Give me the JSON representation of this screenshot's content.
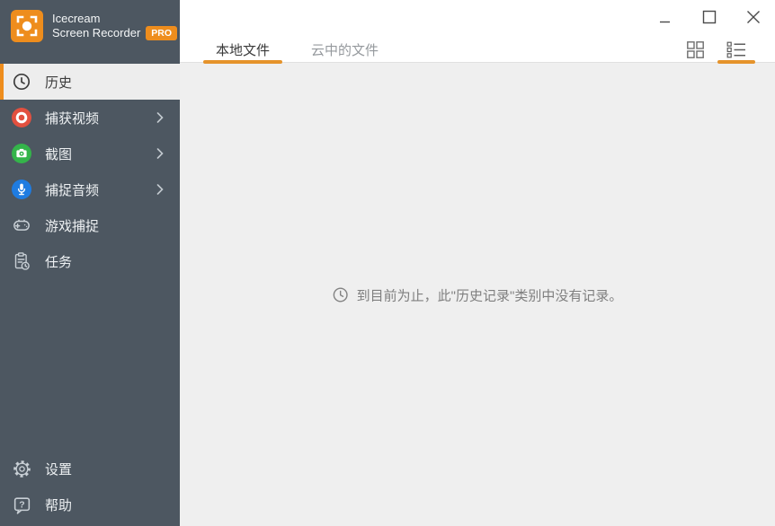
{
  "app": {
    "name_line1": "Icecream",
    "name_line2": "Screen Recorder",
    "badge": "PRO"
  },
  "sidebar": {
    "items": [
      {
        "label": "历史",
        "icon": "clock-icon",
        "selected": true
      },
      {
        "label": "捕获视频",
        "icon": "record-icon",
        "has_submenu": true
      },
      {
        "label": "截图",
        "icon": "camera-icon",
        "has_submenu": true
      },
      {
        "label": "捕捉音频",
        "icon": "microphone-icon",
        "has_submenu": true
      },
      {
        "label": "游戏捕捉",
        "icon": "gamepad-icon"
      },
      {
        "label": "任务",
        "icon": "tasks-icon"
      }
    ],
    "bottom_items": [
      {
        "label": "设置",
        "icon": "gear-icon"
      },
      {
        "label": "帮助",
        "icon": "help-icon"
      }
    ]
  },
  "header": {
    "tabs": [
      {
        "label": "本地文件",
        "active": true
      },
      {
        "label": "云中的文件",
        "active": false
      }
    ],
    "view_toggle": {
      "options": [
        "grid-view-icon",
        "list-view-icon"
      ],
      "active": "list"
    },
    "window_controls": [
      "minimize",
      "maximize",
      "close"
    ]
  },
  "main": {
    "empty_message": "到目前为止，此\"历史记录\"类别中没有记录。",
    "empty_icon": "clock-icon"
  },
  "colors": {
    "accent_orange": "#ee8d1d",
    "underline_orange": "#e5932b",
    "sidebar_bg": "#4d5761",
    "selected_bg": "#ededed",
    "record_red": "#e2503f",
    "camera_green": "#34b44a",
    "mic_blue": "#1f7ce1",
    "main_bg": "#efefef",
    "header_bg": "#ffffff"
  }
}
